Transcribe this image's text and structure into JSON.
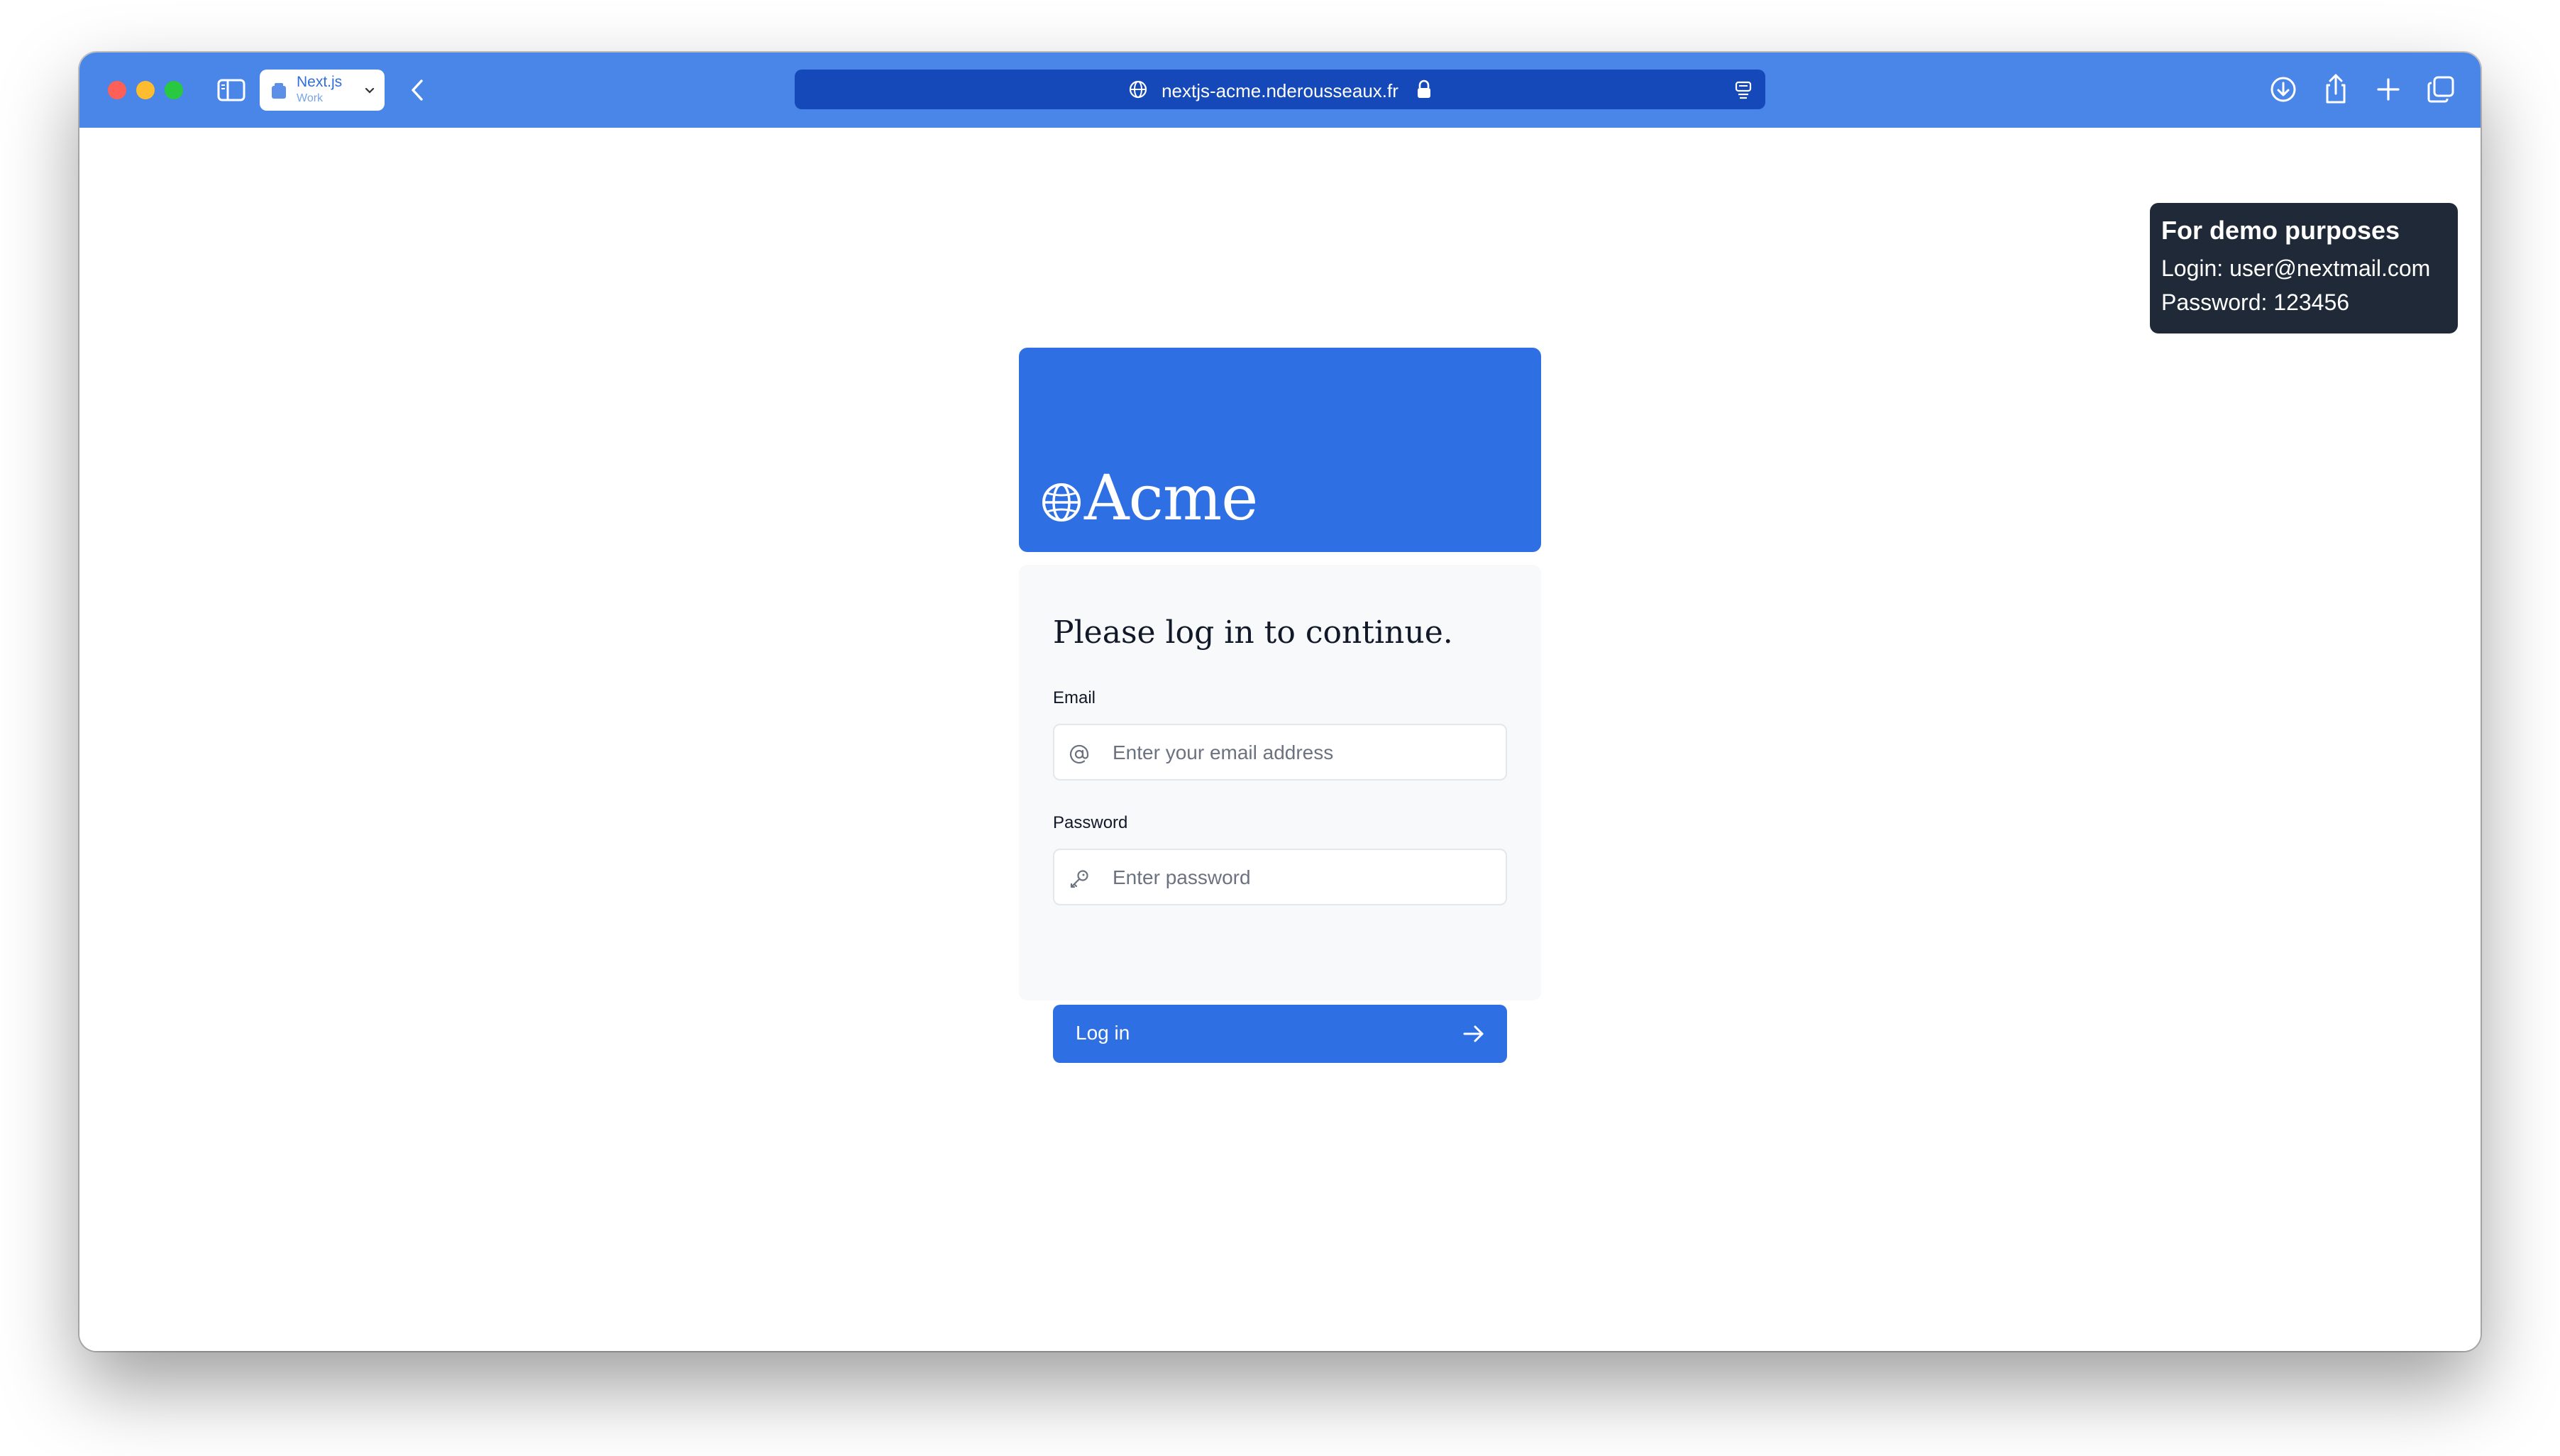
{
  "browser": {
    "tab_group": {
      "title": "Next.js",
      "subtitle": "Work"
    },
    "url": "nextjs-acme.nderousseaux.fr"
  },
  "demo_notice": {
    "title": "For demo purposes",
    "login_line": "Login: user@nextmail.com",
    "password_line": "Password: 123456"
  },
  "brand": {
    "name": "Acme"
  },
  "login": {
    "heading": "Please log in to continue.",
    "email_label": "Email",
    "email_placeholder": "Enter your email address",
    "password_label": "Password",
    "password_placeholder": "Enter password",
    "button_label": "Log in"
  },
  "colors": {
    "toolbar": "#4a86e8",
    "urlbar": "#1548b8",
    "primary": "#2f6fe4",
    "demo_bg": "#1f2937",
    "card_bg": "#f8f9fb"
  },
  "icons": {
    "sidebar": "sidebar-icon",
    "back": "chevron-left-icon",
    "site": "globe-icon",
    "lock": "lock-icon",
    "reader": "reader-icon",
    "download": "download-icon",
    "share": "share-icon",
    "new_tab": "plus-icon",
    "tabs": "tabs-overview-icon",
    "email": "at-sign-icon",
    "password": "key-icon",
    "arrow": "arrow-right-icon"
  }
}
